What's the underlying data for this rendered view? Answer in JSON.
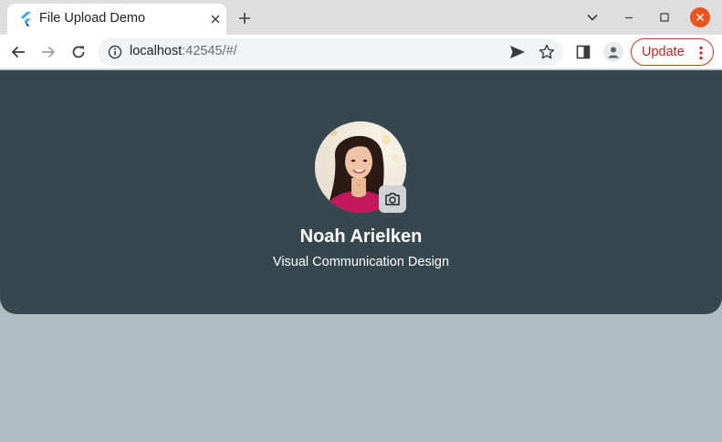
{
  "browser": {
    "tab": {
      "title": "File Upload Demo",
      "favicon": "flutter-icon"
    },
    "address": {
      "host": "localhost",
      "rest": ":42545/#/"
    },
    "update_label": "Update",
    "colors": {
      "update_accent": "#d93025",
      "window_close": "#e95420"
    }
  },
  "profile": {
    "name": "Noah Arielken",
    "subtitle": "Visual Communication Design",
    "avatar": "profile-photo",
    "camera_icon": "camera-icon"
  },
  "colors": {
    "header_bg": "#37474f",
    "page_bg": "#afbcc3"
  }
}
